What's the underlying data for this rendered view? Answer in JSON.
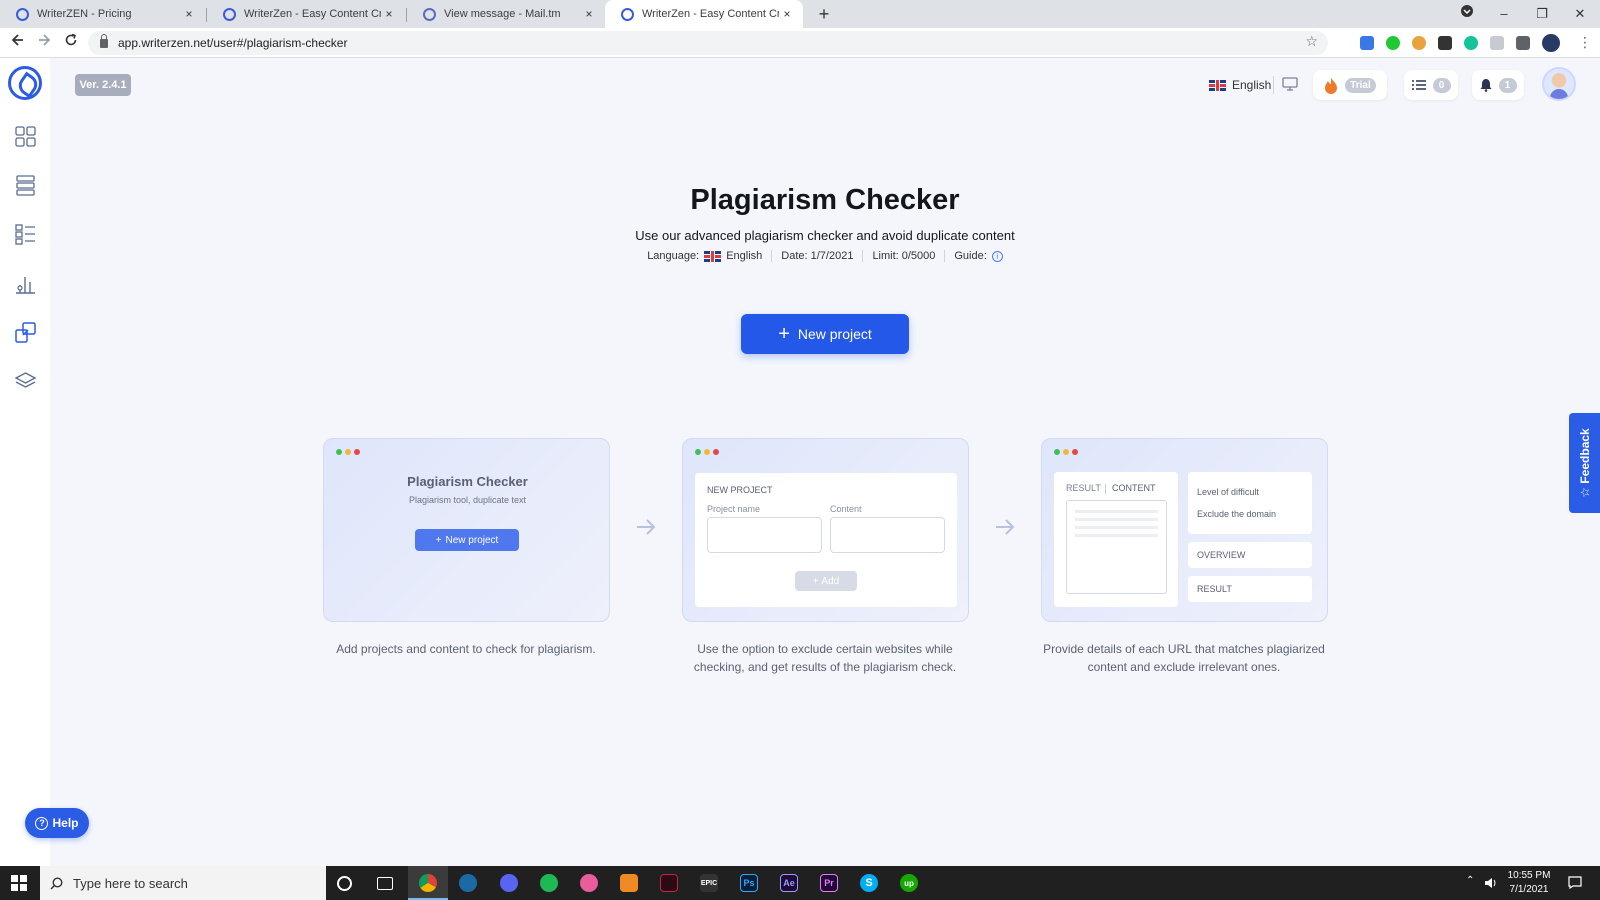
{
  "browser": {
    "tabs": [
      {
        "title": "WriterZEN - Pricing",
        "active": false
      },
      {
        "title": "WriterZen - Easy Content Creator",
        "active": false
      },
      {
        "title": "View message - Mail.tm",
        "active": false
      },
      {
        "title": "WriterZen - Easy Content Creator",
        "active": true
      }
    ],
    "close_glyph": "×",
    "new_tab_glyph": "+",
    "url": "app.writerzen.net/user#/plagiarism-checker",
    "window_controls": {
      "minimize": "–",
      "restore": "❐",
      "close": "✕"
    }
  },
  "app": {
    "version": "Ver. 2.4.1",
    "sidebar": {
      "icons": [
        "grid-icon",
        "keyword-list-icon",
        "topic-icon",
        "chart-icon",
        "copy-plagiarism-icon",
        "layers-icon"
      ],
      "active_index": 4,
      "help_label": "Help"
    },
    "topbar": {
      "language_label": "English",
      "plan_badge": "Trial",
      "tasks_count": "0",
      "notifications_count": "1"
    },
    "main": {
      "title": "Plagiarism Checker",
      "subtitle": "Use our advanced plagiarism checker and avoid duplicate content",
      "meta": {
        "language_prefix": "Language:",
        "language_value": "English",
        "date": "Date: 1/7/2021",
        "limit_prefix": "Limit:",
        "limit_value": "0/5000",
        "guide": "Guide:"
      },
      "cta_label": "New project"
    },
    "steps": [
      {
        "card_title": "Plagiarism Checker",
        "card_subtitle": "Plagiarism tool, duplicate text",
        "card_button": "New project",
        "caption": "Add projects and content to check for plagiarism."
      },
      {
        "card_heading": "NEW PROJECT",
        "field_project_name": "Project name",
        "field_content": "Content",
        "card_button": "Add",
        "caption": "Use the option to exclude certain websites while checking, and get results of the plagiarism check."
      },
      {
        "tab_result": "RESULT",
        "tab_content": "CONTENT",
        "option_level": "Level of difficult",
        "option_exclude": "Exclude the domain",
        "panel_overview": "OVERVIEW",
        "panel_result": "RESULT",
        "caption": "Provide details of each URL that matches plagiarized content and exclude irrelevant ones."
      }
    ],
    "feedback_label": "Feedback",
    "colors": {
      "primary": "#2458e8",
      "page_bg": "#f4f6fc",
      "dot_green": "#3fbf55",
      "dot_yellow": "#f2b63a",
      "dot_red": "#e54646"
    }
  },
  "taskbar": {
    "search_placeholder": "Type here to search",
    "apps": [
      "cortana-icon",
      "task-view-icon",
      "chrome-icon",
      "steam-icon",
      "discord-icon",
      "spotify-icon",
      "itunes-icon",
      "app-orange-icon",
      "vivaldi-icon",
      "epic-games-icon",
      "photoshop-icon",
      "after-effects-icon",
      "premiere-icon",
      "skype-icon",
      "upwork-icon"
    ],
    "app_labels": {
      "epic": "EPIC",
      "ps": "Ps",
      "ae": "Ae",
      "pr": "Pr",
      "skype": "S",
      "upwork": "up"
    },
    "time": "10:55 PM",
    "date": "7/1/2021"
  }
}
